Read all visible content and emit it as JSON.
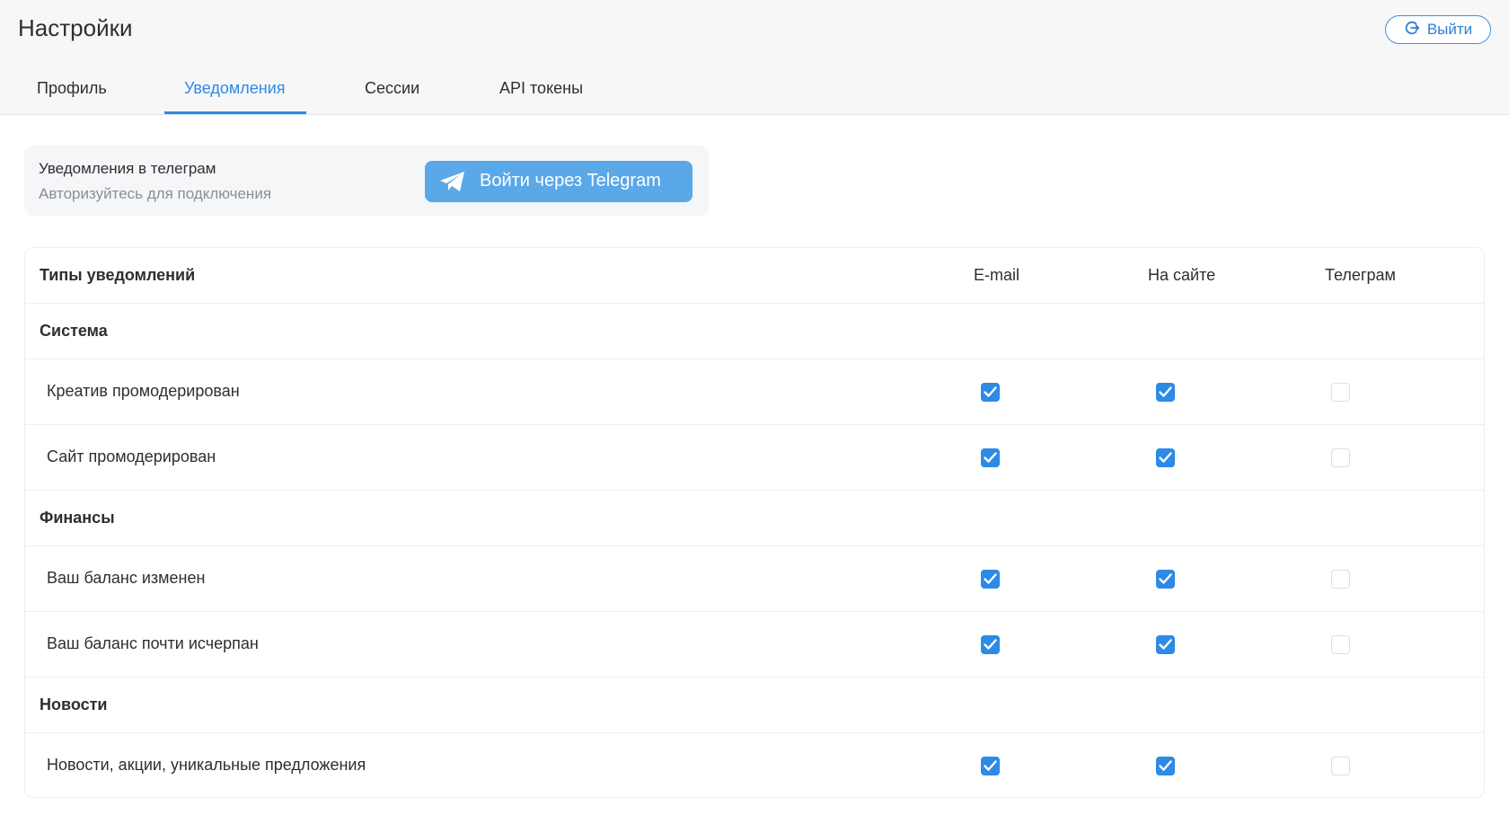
{
  "page": {
    "title": "Настройки"
  },
  "header": {
    "logout_label": "Выйти"
  },
  "tabs": [
    {
      "label": "Профиль",
      "active": false
    },
    {
      "label": "Уведомления",
      "active": true
    },
    {
      "label": "Сессии",
      "active": false
    },
    {
      "label": "API токены",
      "active": false
    }
  ],
  "telegram": {
    "title": "Уведомления в телеграм",
    "subtitle": "Авторизуйтесь для подключения",
    "login_label": "Войти через Telegram"
  },
  "table": {
    "headers": {
      "types": "Типы уведомлений",
      "email": "E-mail",
      "site": "На сайте",
      "telegram": "Телеграм"
    },
    "groups": [
      {
        "name": "Система",
        "items": [
          {
            "label": "Креатив промодерирован",
            "email": true,
            "site": true,
            "telegram": false
          },
          {
            "label": "Сайт промодерирован",
            "email": true,
            "site": true,
            "telegram": false
          }
        ]
      },
      {
        "name": "Финансы",
        "items": [
          {
            "label": "Ваш баланс изменен",
            "email": true,
            "site": true,
            "telegram": false
          },
          {
            "label": "Ваш баланс почти исчерпан",
            "email": true,
            "site": true,
            "telegram": false
          }
        ]
      },
      {
        "name": "Новости",
        "items": [
          {
            "label": "Новости, акции, уникальные предложения",
            "email": true,
            "site": true,
            "telegram": false
          }
        ]
      }
    ]
  },
  "colors": {
    "accent": "#2d8ae6",
    "telegram_button": "#5aa8e8",
    "header_bg": "#f7f7f8"
  }
}
